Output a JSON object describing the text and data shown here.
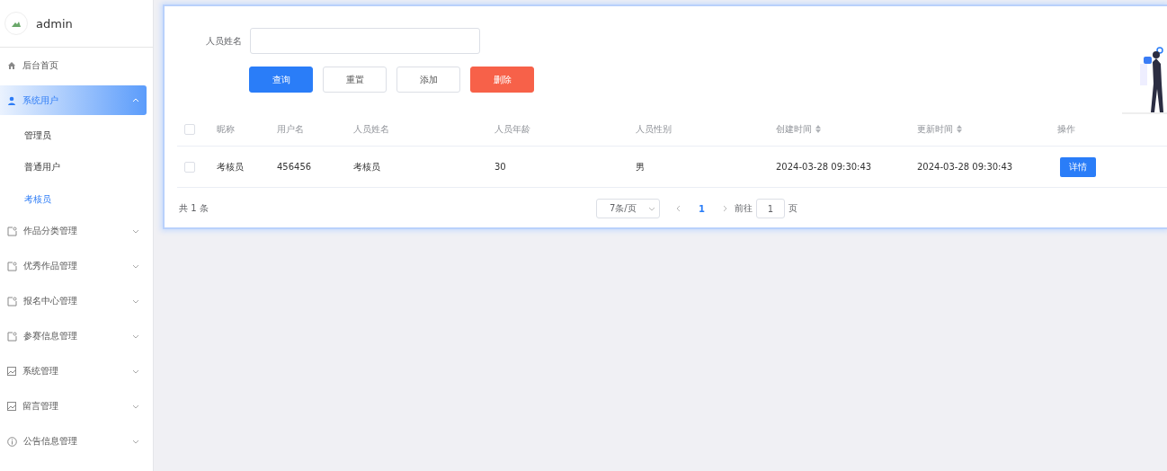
{
  "sidebar": {
    "user": "admin",
    "items": [
      {
        "label": "后台首页",
        "kind": "home",
        "selected": false
      },
      {
        "label": "系统用户",
        "kind": "user",
        "expanded": true,
        "selected": true,
        "children": [
          {
            "label": "管理员",
            "selected": false
          },
          {
            "label": "普通用户",
            "selected": false
          },
          {
            "label": "考核员",
            "selected": true
          }
        ]
      },
      {
        "label": "作品分类管理",
        "kind": "tag",
        "expanded": false,
        "selected": false
      },
      {
        "label": "优秀作品管理",
        "kind": "tag",
        "expanded": false,
        "selected": false
      },
      {
        "label": "报名中心管理",
        "kind": "tag",
        "expanded": false,
        "selected": false
      },
      {
        "label": "参赛信息管理",
        "kind": "tag",
        "expanded": false,
        "selected": false
      },
      {
        "label": "系统管理",
        "kind": "image",
        "expanded": false,
        "selected": false
      },
      {
        "label": "留言管理",
        "kind": "image",
        "expanded": false,
        "selected": false
      },
      {
        "label": "公告信息管理",
        "kind": "info",
        "expanded": false,
        "selected": false
      }
    ]
  },
  "search": {
    "label": "人员姓名"
  },
  "buttons": [
    {
      "label": "查询",
      "kind": "primary"
    },
    {
      "label": "重置",
      "kind": "plain"
    },
    {
      "label": "添加",
      "kind": "plain"
    },
    {
      "label": "删除",
      "kind": "danger"
    }
  ],
  "table": {
    "all_checked": false,
    "columns": [
      {
        "label": "昵称",
        "kind": "plain"
      },
      {
        "label": "用户名",
        "kind": "plain"
      },
      {
        "label": "人员姓名",
        "kind": "plain"
      },
      {
        "label": "人员年龄",
        "kind": "plain"
      },
      {
        "label": "人员性别",
        "kind": "plain"
      },
      {
        "label": "创建时间",
        "kind": "sortable"
      },
      {
        "label": "更新时间",
        "kind": "sortable"
      },
      {
        "label": "操作",
        "kind": "plain"
      }
    ],
    "rows": [
      {
        "checked": false,
        "cells": [
          "考核员",
          "456456",
          "考核员",
          "30",
          "男",
          "2024-03-28 09:30:43",
          "2024-03-28 09:30:43"
        ],
        "action": "详情"
      }
    ]
  },
  "pagination": {
    "total": "共 1 条",
    "page_size": "7条/页",
    "pages": [
      {
        "label": "1",
        "selected": true
      }
    ],
    "goto_label": "前往",
    "goto_value": "1",
    "goto_suffix": "页"
  }
}
